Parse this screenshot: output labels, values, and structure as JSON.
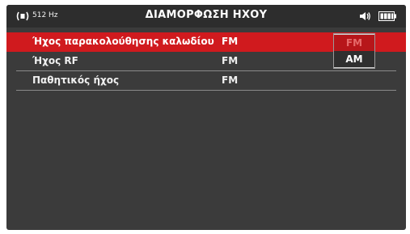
{
  "status": {
    "frequency": "512 Hz",
    "title": "ΔΙΑΜΟΡΦΩΣΗ ΗΧΟΥ",
    "signal_icon": "signal-broadcast-icon",
    "speaker_icon": "speaker-icon",
    "battery_icon": "battery-icon"
  },
  "rows": [
    {
      "label": "Ήχος παρακολούθησης καλωδίου",
      "value": "FM"
    },
    {
      "label": "Ήχος RF",
      "value": "FM"
    },
    {
      "label": "Παθητικός ήχος",
      "value": "FM"
    }
  ],
  "dropdown": {
    "options": [
      "FM",
      "AM"
    ],
    "selected": "FM"
  },
  "colors": {
    "accent": "#d01a1e",
    "background": "#3b3b3b",
    "statusbar": "#2d2d2d"
  }
}
